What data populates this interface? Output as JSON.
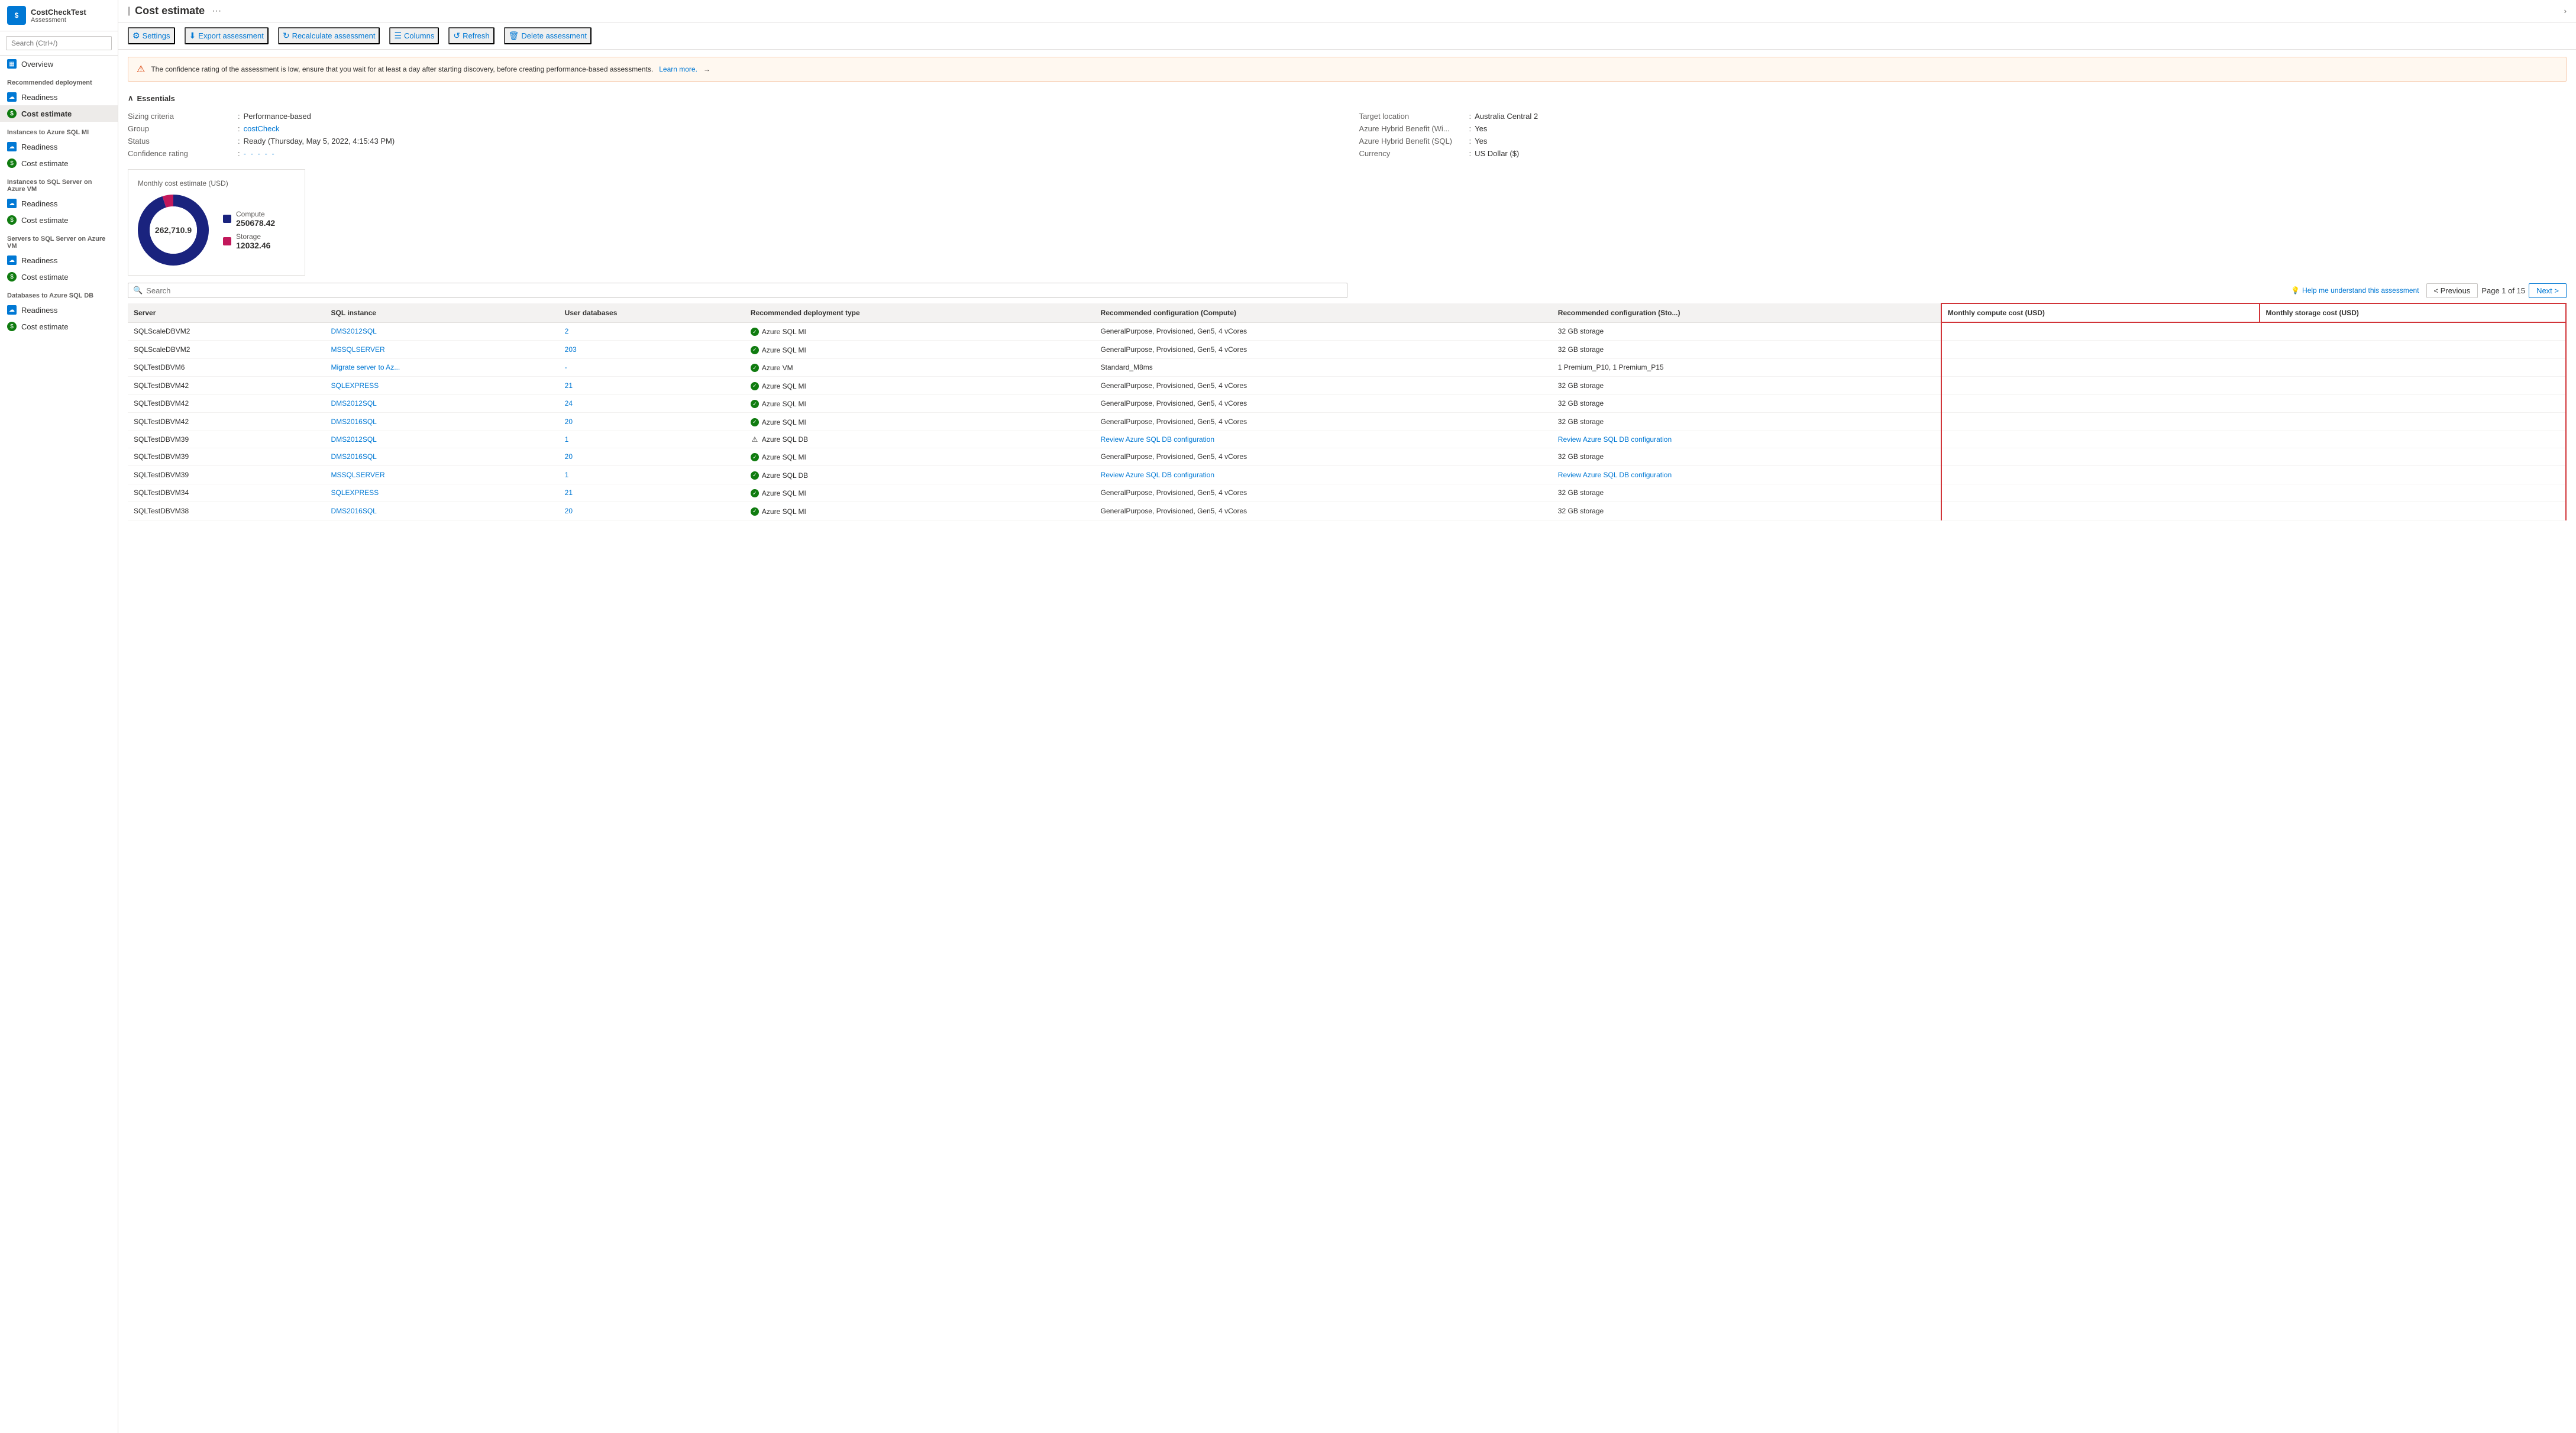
{
  "app": {
    "logo_text": "$",
    "title": "CostCheckTest",
    "subtitle": "Assessment",
    "search_placeholder": "Search (Ctrl+/)"
  },
  "sidebar": {
    "overview_label": "Overview",
    "sections": [
      {
        "title": "Recommended deployment",
        "items": [
          {
            "label": "Readiness",
            "type": "blue",
            "active": false
          },
          {
            "label": "Cost estimate",
            "type": "green",
            "active": true
          }
        ]
      },
      {
        "title": "Instances to Azure SQL MI",
        "items": [
          {
            "label": "Readiness",
            "type": "blue",
            "active": false
          },
          {
            "label": "Cost estimate",
            "type": "green",
            "active": false
          }
        ]
      },
      {
        "title": "Instances to SQL Server on Azure VM",
        "items": [
          {
            "label": "Readiness",
            "type": "blue",
            "active": false
          },
          {
            "label": "Cost estimate",
            "type": "green",
            "active": false
          }
        ]
      },
      {
        "title": "Servers to SQL Server on Azure VM",
        "items": [
          {
            "label": "Readiness",
            "type": "blue",
            "active": false
          },
          {
            "label": "Cost estimate",
            "type": "green",
            "active": false
          }
        ]
      },
      {
        "title": "Databases to Azure SQL DB",
        "items": [
          {
            "label": "Readiness",
            "type": "blue",
            "active": false
          },
          {
            "label": "Cost estimate",
            "type": "green",
            "active": false
          }
        ]
      }
    ]
  },
  "toolbar": {
    "settings_label": "Settings",
    "export_label": "Export assessment",
    "recalculate_label": "Recalculate assessment",
    "columns_label": "Columns",
    "refresh_label": "Refresh",
    "delete_label": "Delete assessment"
  },
  "banner": {
    "text": "The confidence rating of the assessment is low, ensure that you wait for at least a day after starting discovery, before creating performance-based assessments.",
    "link_text": "Learn more.",
    "arrow": "→"
  },
  "essentials": {
    "title": "Essentials",
    "left": [
      {
        "label": "Sizing criteria",
        "value": "Performance-based"
      },
      {
        "label": "Group",
        "value": "costCheck",
        "link": true
      },
      {
        "label": "Status",
        "value": "Ready (Thursday, May 5, 2022, 4:15:43 PM)"
      },
      {
        "label": "Confidence rating",
        "value": "- - - - -",
        "dashes": true
      }
    ],
    "right": [
      {
        "label": "Target location",
        "value": "Australia Central 2"
      },
      {
        "label": "Azure Hybrid Benefit (Wi...",
        "value": "Yes"
      },
      {
        "label": "Azure Hybrid Benefit (SQL)",
        "value": "Yes"
      },
      {
        "label": "Currency",
        "value": "US Dollar ($)"
      }
    ]
  },
  "chart": {
    "title": "Monthly cost estimate (USD)",
    "center_value": "262,710.9",
    "legend": [
      {
        "label": "Compute",
        "value": "250678.42",
        "color": "#1a237e"
      },
      {
        "label": "Storage",
        "value": "12032.46",
        "color": "#c2185b"
      }
    ],
    "compute_percent": 95,
    "storage_percent": 5
  },
  "table": {
    "search_placeholder": "Search",
    "help_link": "Help me understand this assessment",
    "pagination": {
      "previous_label": "< Previous",
      "next_label": "Next >",
      "page_info": "Page 1 of 15"
    },
    "columns": [
      "Server",
      "SQL instance",
      "User databases",
      "Recommended deployment type",
      "Recommended configuration (Compute)",
      "Recommended configuration (Sto...",
      "Monthly compute cost (USD)",
      "Monthly storage cost (USD)"
    ],
    "rows": [
      {
        "server": "SQLScaleDBVM2",
        "sql_instance": "DMS2012SQL",
        "user_db": "2",
        "deployment": "Azure SQL MI",
        "deployment_status": "check",
        "config_compute": "GeneralPurpose, Provisioned, Gen5, 4 vCores",
        "config_storage": "32 GB storage",
        "monthly_compute": "",
        "monthly_storage": ""
      },
      {
        "server": "SQLScaleDBVM2",
        "sql_instance": "MSSQLSERVER",
        "user_db": "203",
        "deployment": "Azure SQL MI",
        "deployment_status": "check",
        "config_compute": "GeneralPurpose, Provisioned, Gen5, 4 vCores",
        "config_storage": "32 GB storage",
        "monthly_compute": "",
        "monthly_storage": ""
      },
      {
        "server": "SQLTestDBVM6",
        "sql_instance": "Migrate server to Az...",
        "user_db": "-",
        "deployment": "Azure VM",
        "deployment_status": "check",
        "config_compute": "Standard_M8ms",
        "config_storage": "1 Premium_P10, 1 Premium_P15",
        "monthly_compute": "",
        "monthly_storage": ""
      },
      {
        "server": "SQLTestDBVM42",
        "sql_instance": "SQLEXPRESS",
        "user_db": "21",
        "deployment": "Azure SQL MI",
        "deployment_status": "check",
        "config_compute": "GeneralPurpose, Provisioned, Gen5, 4 vCores",
        "config_storage": "32 GB storage",
        "monthly_compute": "",
        "monthly_storage": ""
      },
      {
        "server": "SQLTestDBVM42",
        "sql_instance": "DMS2012SQL",
        "user_db": "24",
        "deployment": "Azure SQL MI",
        "deployment_status": "check",
        "config_compute": "GeneralPurpose, Provisioned, Gen5, 4 vCores",
        "config_storage": "32 GB storage",
        "monthly_compute": "",
        "monthly_storage": ""
      },
      {
        "server": "SQLTestDBVM42",
        "sql_instance": "DMS2016SQL",
        "user_db": "20",
        "deployment": "Azure SQL MI",
        "deployment_status": "check",
        "config_compute": "GeneralPurpose, Provisioned, Gen5, 4 vCores",
        "config_storage": "32 GB storage",
        "monthly_compute": "",
        "monthly_storage": ""
      },
      {
        "server": "SQLTestDBVM39",
        "sql_instance": "DMS2012SQL",
        "user_db": "1",
        "deployment": "Azure SQL DB",
        "deployment_status": "warn",
        "config_compute": "Review Azure SQL DB configuration",
        "config_storage": "Review Azure SQL DB configuration",
        "config_compute_link": true,
        "config_storage_link": true,
        "monthly_compute": "",
        "monthly_storage": ""
      },
      {
        "server": "SQLTestDBVM39",
        "sql_instance": "DMS2016SQL",
        "user_db": "20",
        "deployment": "Azure SQL MI",
        "deployment_status": "check",
        "config_compute": "GeneralPurpose, Provisioned, Gen5, 4 vCores",
        "config_storage": "32 GB storage",
        "monthly_compute": "",
        "monthly_storage": ""
      },
      {
        "server": "SQLTestDBVM39",
        "sql_instance": "MSSQLSERVER",
        "user_db": "1",
        "deployment": "Azure SQL DB",
        "deployment_status": "check",
        "config_compute": "Review Azure SQL DB configuration",
        "config_storage": "Review Azure SQL DB configuration",
        "config_compute_link": true,
        "config_storage_link": true,
        "monthly_compute": "",
        "monthly_storage": ""
      },
      {
        "server": "SQLTestDBVM34",
        "sql_instance": "SQLEXPRESS",
        "user_db": "21",
        "deployment": "Azure SQL MI",
        "deployment_status": "check",
        "config_compute": "GeneralPurpose, Provisioned, Gen5, 4 vCores",
        "config_storage": "32 GB storage",
        "monthly_compute": "",
        "monthly_storage": ""
      },
      {
        "server": "SQLTestDBVM38",
        "sql_instance": "DMS2016SQL",
        "user_db": "20",
        "deployment": "Azure SQL MI",
        "deployment_status": "check",
        "config_compute": "GeneralPurpose, Provisioned, Gen5, 4 vCores",
        "config_storage": "32 GB storage",
        "monthly_compute": "",
        "monthly_storage": ""
      }
    ]
  }
}
